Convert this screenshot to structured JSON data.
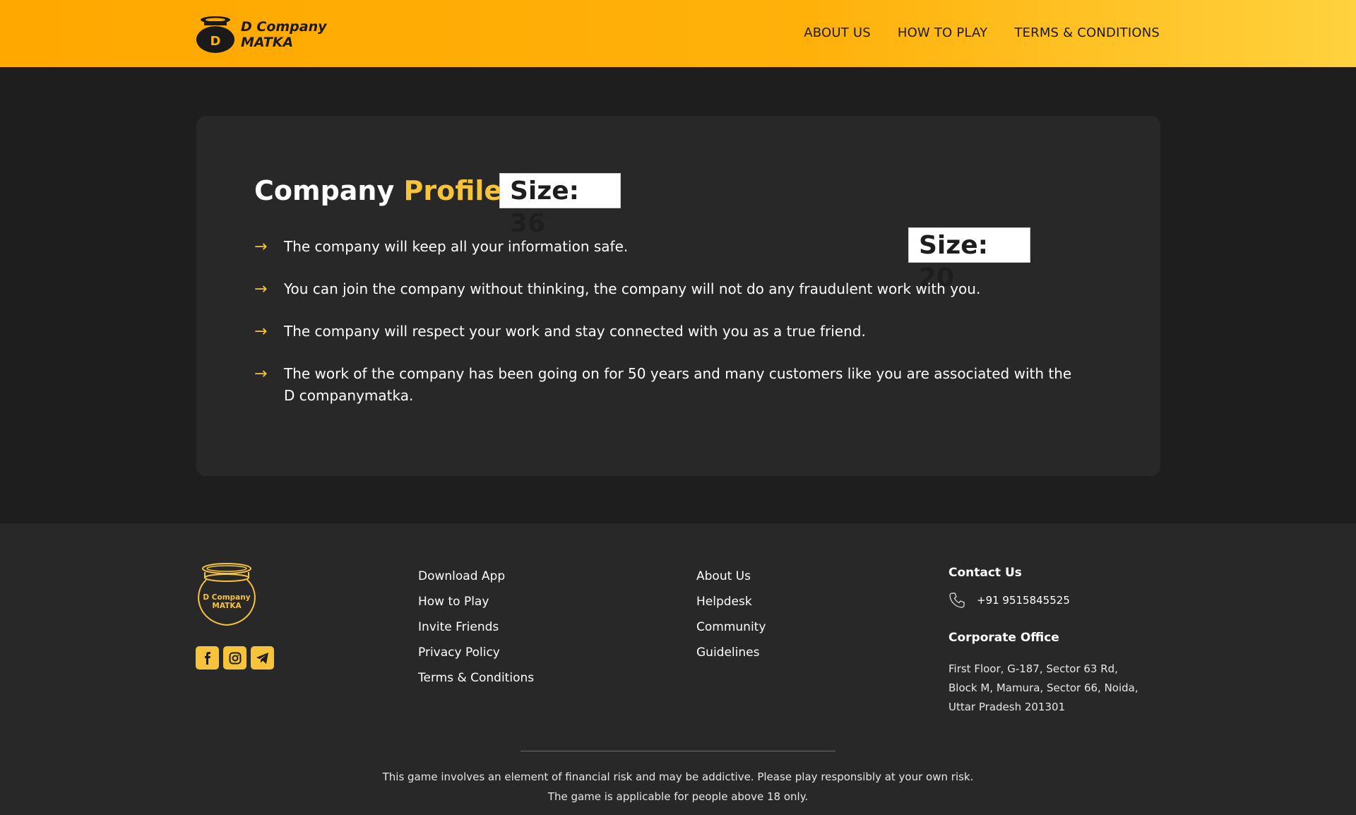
{
  "header": {
    "logo_line1": "D Company",
    "logo_line2": "MATKA",
    "logo_letter": "D",
    "nav": [
      "ABOUT US",
      "HOW TO PLAY",
      "TERMS & CONDITIONS"
    ]
  },
  "main": {
    "title_part1": "Company",
    "title_part2": "Profile",
    "size_badge_1": "Size: 36",
    "size_badge_2": "Size: 20",
    "arrow_glyph": "→",
    "points": [
      "The company will keep all your information safe.",
      "You can join the company without thinking, the company will not do any fraudulent work with you.",
      "The company will respect your work and stay connected with you as a true friend.",
      "The work of the company has been going on for 50 years and many customers like you are associated with the D companymatka."
    ]
  },
  "footer": {
    "logo_line1": "D Company",
    "logo_line2": "MATKA",
    "social_icons": [
      "facebook-icon",
      "instagram-icon",
      "telegram-icon"
    ],
    "col1": [
      "Download App",
      "How to Play",
      "Invite Friends",
      "Privacy Policy",
      "Terms & Conditions"
    ],
    "col2": [
      "About Us",
      "Helpdesk",
      "Community",
      "Guidelines"
    ],
    "contact_heading": "Contact Us",
    "phone": "+91 9515845525",
    "office_heading": "Corporate Office",
    "address": [
      "First Floor, G-187, Sector 63 Rd,",
      "Block M, Mamura, Sector 66, Noida,",
      "Uttar Pradesh 201301"
    ],
    "disclaimer_line1": "This game involves an element of financial risk and may be addictive. Please play responsibly at your own risk.",
    "disclaimer_line2": "The game is applicable for people above 18 only."
  },
  "colors": {
    "accent": "#f7c33b",
    "header_gradient_start": "#ffa800",
    "header_gradient_end": "#ffd23e",
    "background": "#1e1e1e",
    "card": "#282828"
  }
}
